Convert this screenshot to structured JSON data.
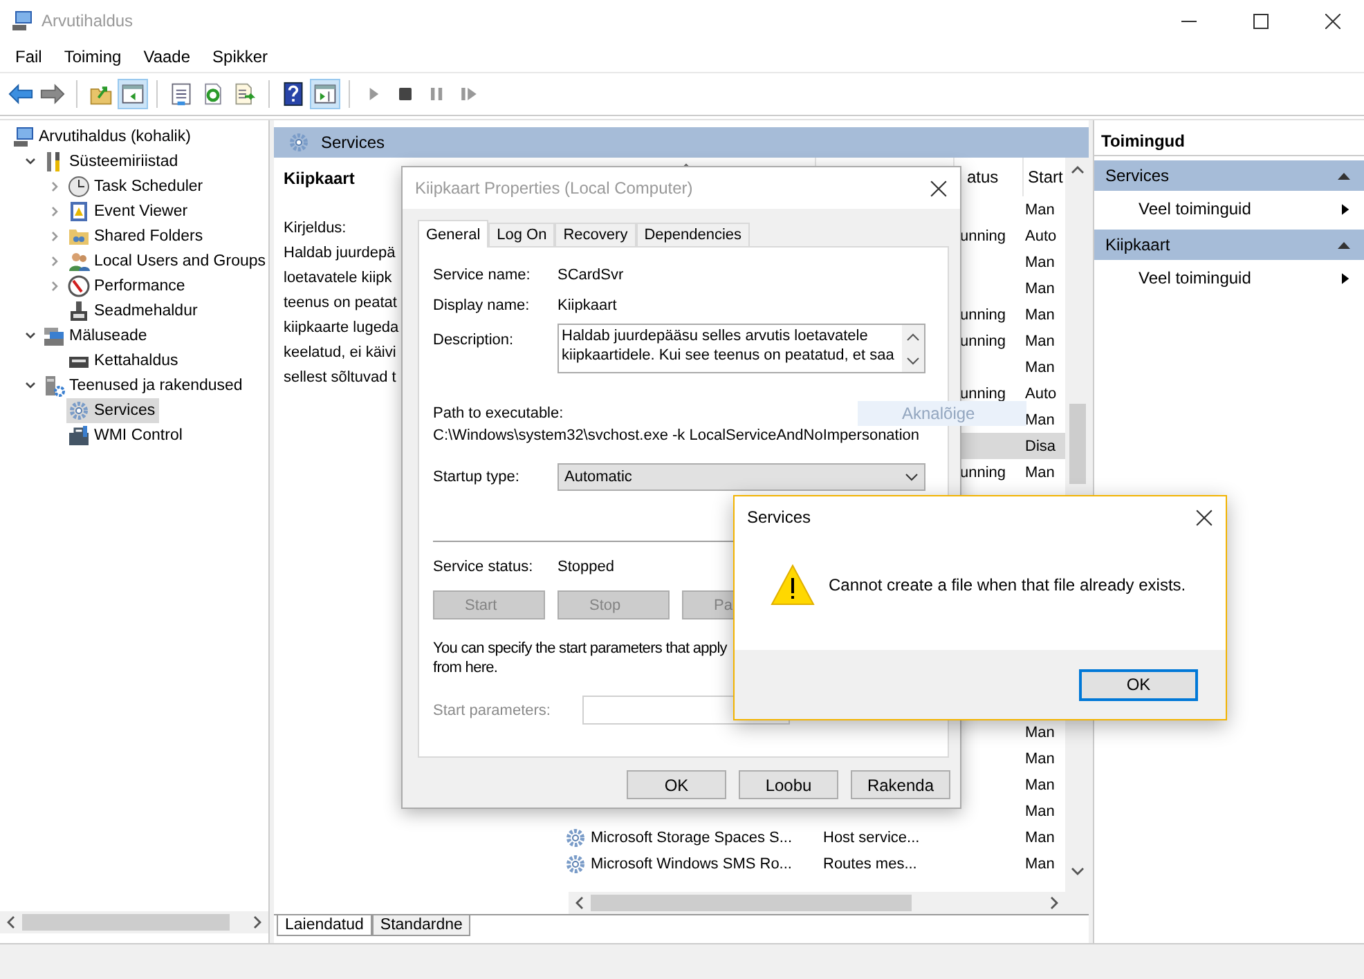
{
  "window": {
    "title": "Arvutihaldus"
  },
  "menu": [
    "Fail",
    "Toiming",
    "Vaade",
    "Spikker"
  ],
  "toolbar": [
    {
      "pressed": false
    },
    {
      "pressed": false
    },
    {
      "pressed": false
    },
    {
      "pressed": true
    },
    {
      "pressed": false
    },
    {
      "pressed": false
    },
    {
      "pressed": false
    },
    {
      "pressed": false
    },
    {
      "pressed": true
    },
    {
      "pressed": false
    },
    {
      "pressed": false
    },
    {
      "pressed": false
    },
    {
      "pressed": false
    }
  ],
  "tree": [
    {
      "label": "Arvutihaldus (kohalik)",
      "selected": false,
      "children": [
        {
          "label": "Süsteemiriistad",
          "expanded": true,
          "selected": false,
          "children": [
            {
              "label": "Task Scheduler",
              "expanded": false,
              "selected": false
            },
            {
              "label": "Event Viewer",
              "expanded": false,
              "selected": false
            },
            {
              "label": "Shared Folders",
              "expanded": false,
              "selected": false
            },
            {
              "label": "Local Users and Groups",
              "expanded": false,
              "selected": false
            },
            {
              "label": "Performance",
              "expanded": false,
              "selected": false
            },
            {
              "label": "Seadmehaldur",
              "selected": false
            }
          ]
        },
        {
          "label": "Mäluseade",
          "expanded": true,
          "selected": false,
          "children": [
            {
              "label": "Kettahaldus",
              "selected": false
            }
          ]
        },
        {
          "label": "Teenused ja rakendused",
          "expanded": true,
          "selected": false,
          "children": [
            {
              "label": "Services",
              "selected": true
            },
            {
              "label": "WMI Control",
              "selected": false
            }
          ]
        }
      ]
    }
  ],
  "center": {
    "header": "Services",
    "details": {
      "title": "Kiipkaart",
      "heading": "Kirjeldus:",
      "lines": [
        "Haldab juurdepä",
        "loetavatele kiipk",
        "teenus on peatat",
        "kiipkaarte lugeda",
        "keelatud, ei käivi",
        "sellest sõltuvad t"
      ]
    },
    "list": {
      "columns": [
        {
          "sorted": true
        },
        {},
        {
          "label": "atus"
        },
        {
          "label": "Start"
        }
      ],
      "upper_rows": [
        {
          "startup": "Man",
          "selected": false
        },
        {
          "status": "unning",
          "startup": "Auto",
          "selected": false
        },
        {
          "startup": "Man",
          "selected": false
        },
        {
          "startup": "Man",
          "selected": false
        },
        {
          "status": "unning",
          "startup": "Man",
          "selected": false
        },
        {
          "status": "unning",
          "startup": "Man",
          "selected": false
        },
        {
          "startup": "Man",
          "selected": false
        },
        {
          "status": "unning",
          "startup": "Auto",
          "selected": false
        },
        {
          "startup": "Man",
          "selected": false
        },
        {
          "startup": "Disa",
          "selected": true
        },
        {
          "status": "unning",
          "startup": "Man",
          "selected": false
        }
      ],
      "lower_rows": [
        {
          "startup": "Man",
          "selected": false
        },
        {
          "startup": "Man",
          "selected": false
        },
        {
          "startup": "Man",
          "selected": false
        },
        {
          "startup": "Man",
          "selected": false
        },
        {
          "name": "Microsoft Storage Spaces S...",
          "description": "Host service...",
          "startup": "Man",
          "selected": false
        },
        {
          "name": "Microsoft Windows SMS Ro...",
          "description": "Routes mes...",
          "startup": "Man",
          "selected": false
        }
      ]
    },
    "hint": "Aknalõige",
    "tabs": [
      {
        "label": "Laiendatud",
        "selected": true
      },
      {
        "label": "Standardne",
        "selected": false
      }
    ]
  },
  "actions": {
    "title": "Toimingud",
    "sections": [
      {
        "title": "Services",
        "expanded": true,
        "items": [
          "Veel toiminguid"
        ]
      },
      {
        "title": "Kiipkaart",
        "expanded": true,
        "items": [
          "Veel toiminguid"
        ]
      }
    ]
  },
  "properties_dialog": {
    "title": "Kiipkaart Properties (Local Computer)",
    "tabs": [
      {
        "label": "General",
        "selected": true
      },
      {
        "label": "Log On",
        "selected": false
      },
      {
        "label": "Recovery",
        "selected": false
      },
      {
        "label": "Dependencies",
        "selected": false
      }
    ],
    "service_name": {
      "label": "Service name:",
      "value": "SCardSvr"
    },
    "display_name": {
      "label": "Display name:",
      "value": "Kiipkaart"
    },
    "description": {
      "label": "Description:",
      "value": "Haldab juurdepääsu selles arvutis loetavatele kiipkaartidele. Kui see teenus on peatatud, et saa"
    },
    "path": {
      "label": "Path to executable:",
      "value": "C:\\Windows\\system32\\svchost.exe -k LocalServiceAndNoImpersonation"
    },
    "startup_type": {
      "label": "Startup type:",
      "value": "Automatic"
    },
    "service_status": {
      "label": "Service status:",
      "value": "Stopped"
    },
    "service_buttons": [
      {
        "label": "Start",
        "disabled": true
      },
      {
        "label": "Stop",
        "disabled": true
      },
      {
        "label": "Pa",
        "disabled": true
      }
    ],
    "help_lines": [
      "You can specify the start parameters that apply",
      "from here."
    ],
    "start_parameters": {
      "label": "Start parameters:",
      "disabled": true
    },
    "buttons": [
      "OK",
      "Loobu",
      "Rakenda"
    ]
  },
  "message_box": {
    "title": "Services",
    "message": "Cannot create a file when that file already exists.",
    "button": "OK"
  }
}
